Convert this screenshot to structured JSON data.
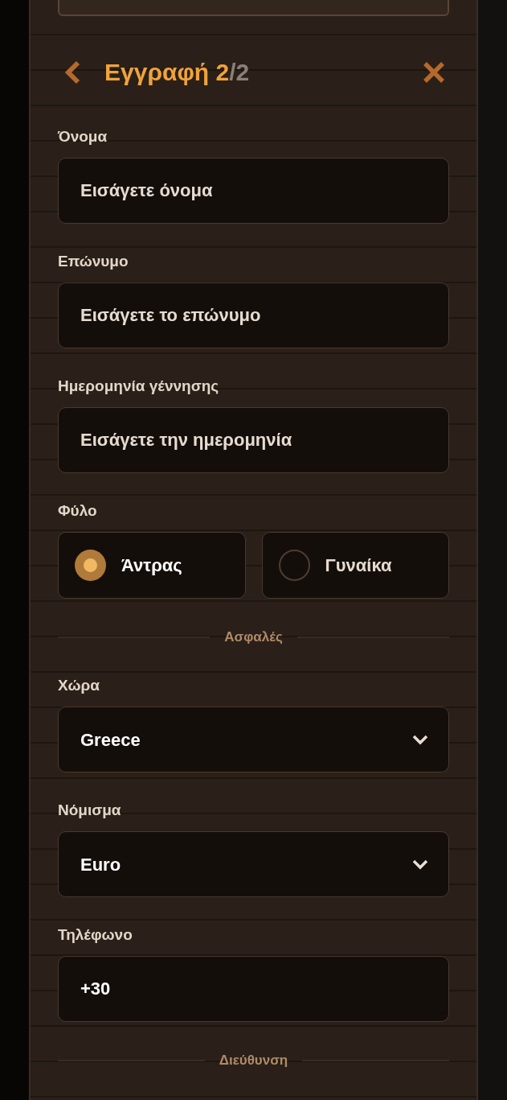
{
  "header": {
    "title": "Εγγραφή 2",
    "step": "/2"
  },
  "form": [
    {
      "kind": "text",
      "label": "Όνομα",
      "placeholder": "Εισάγετε όνομα"
    },
    {
      "kind": "text",
      "label": "Επώνυμο",
      "placeholder": "Εισάγετε το επώνυμο"
    },
    {
      "kind": "text",
      "label": "Ημερομηνία γέννησης",
      "placeholder": "Εισάγετε την ημερομηνία"
    },
    {
      "kind": "radio",
      "label": "Φύλο",
      "options": [
        {
          "label": "Άντρας",
          "selected": true
        },
        {
          "label": "Γυναίκα",
          "selected": false
        }
      ]
    },
    {
      "kind": "divider",
      "label": "Ασφαλές"
    },
    {
      "kind": "select",
      "label": "Χώρα",
      "value": "Greece"
    },
    {
      "kind": "select",
      "label": "Νόμισμα",
      "value": "Euro"
    },
    {
      "kind": "value",
      "label": "Τηλέφωνο",
      "value": "+30"
    },
    {
      "kind": "divider",
      "label": "Διεύθυνση"
    }
  ]
}
